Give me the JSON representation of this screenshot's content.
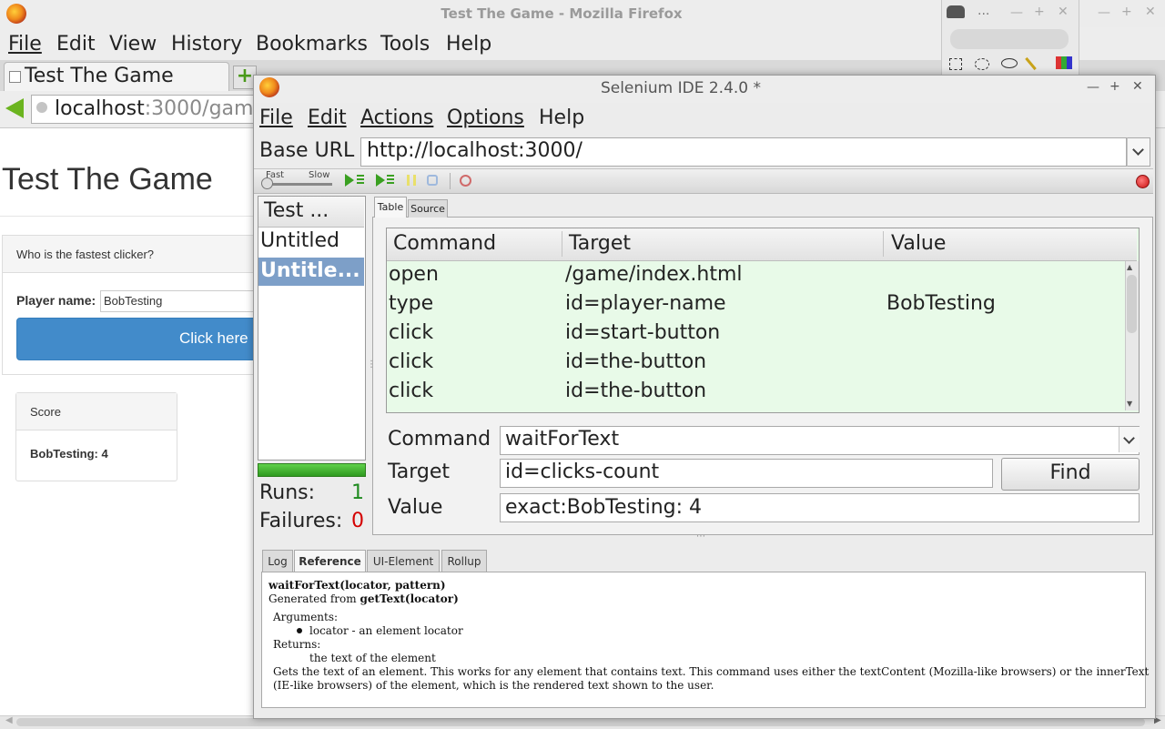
{
  "firefox": {
    "window_title": "Test The Game - Mozilla Firefox",
    "menu": [
      "File",
      "Edit",
      "View",
      "History",
      "Bookmarks",
      "Tools",
      "Help"
    ],
    "tab_title": "Test The Game",
    "new_tab_icon": "plus-icon",
    "url_host": "localhost",
    "url_rest": ":3000/gam"
  },
  "page": {
    "title": "Test The Game",
    "question": "Who is the fastest clicker?",
    "player_label": "Player name:",
    "player_value": "BobTesting",
    "click_button": "Click here",
    "score_title": "Score",
    "score_value": "BobTesting: 4",
    "accent_color": "#428bca"
  },
  "gimp": {
    "title": "...",
    "tools": [
      "rect-select-icon",
      "ellipse-select-icon",
      "lasso-icon",
      "fuzzy-select-icon",
      "color-select-icon"
    ]
  },
  "selenium": {
    "window_title": "Selenium IDE 2.4.0 *",
    "menu": [
      "File",
      "Edit",
      "Actions",
      "Options",
      "Help"
    ],
    "base_url_label": "Base URL",
    "base_url": "http://localhost:3000/",
    "speed_fast": "Fast",
    "speed_slow": "Slow",
    "test_list_header": "Test ...",
    "test_cases": [
      "Untitled",
      "Untitle..."
    ],
    "runs_label": "Runs:",
    "runs": "1",
    "failures_label": "Failures:",
    "failures": "0",
    "tabs": [
      "Table",
      "Source"
    ],
    "columns": [
      "Command",
      "Target",
      "Value"
    ],
    "commands": [
      {
        "command": "open",
        "target": "/game/index.html",
        "value": ""
      },
      {
        "command": "type",
        "target": "id=player-name",
        "value": "BobTesting"
      },
      {
        "command": "click",
        "target": "id=start-button",
        "value": ""
      },
      {
        "command": "click",
        "target": "id=the-button",
        "value": ""
      },
      {
        "command": "click",
        "target": "id=the-button",
        "value": ""
      }
    ],
    "command_label": "Command",
    "command_value": "waitForText",
    "target_label": "Target",
    "target_value": "id=clicks-count",
    "find_label": "Find",
    "value_label": "Value",
    "value_value": "exact:BobTesting: 4",
    "bottom_tabs": [
      "Log",
      "Reference",
      "UI-Element",
      "Rollup"
    ],
    "reference": {
      "signature": "waitForText(locator, pattern)",
      "generated_prefix": "Generated from ",
      "generated_from": "getText(locator)",
      "arguments_label": "Arguments:",
      "argument": "locator - an element locator",
      "returns_label": "Returns:",
      "returns": "the text of the element",
      "description_1": "Gets the text of an element. This works for any element that contains text. This command uses either the textContent (Mozilla-like browsers) or the innerText",
      "description_2": "(IE-like browsers) of the element, which is the rendered text shown to the user."
    }
  }
}
